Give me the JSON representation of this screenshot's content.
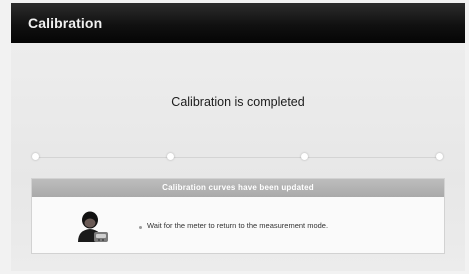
{
  "window": {
    "title": "Calibration"
  },
  "main": {
    "status_text": "Calibration is completed"
  },
  "progress": {
    "steps": 4,
    "current_step": 4
  },
  "panel": {
    "header": "Calibration curves have been updated",
    "message": "Wait for the meter to return to the measurement mode.",
    "icon": "operator-icon"
  }
}
